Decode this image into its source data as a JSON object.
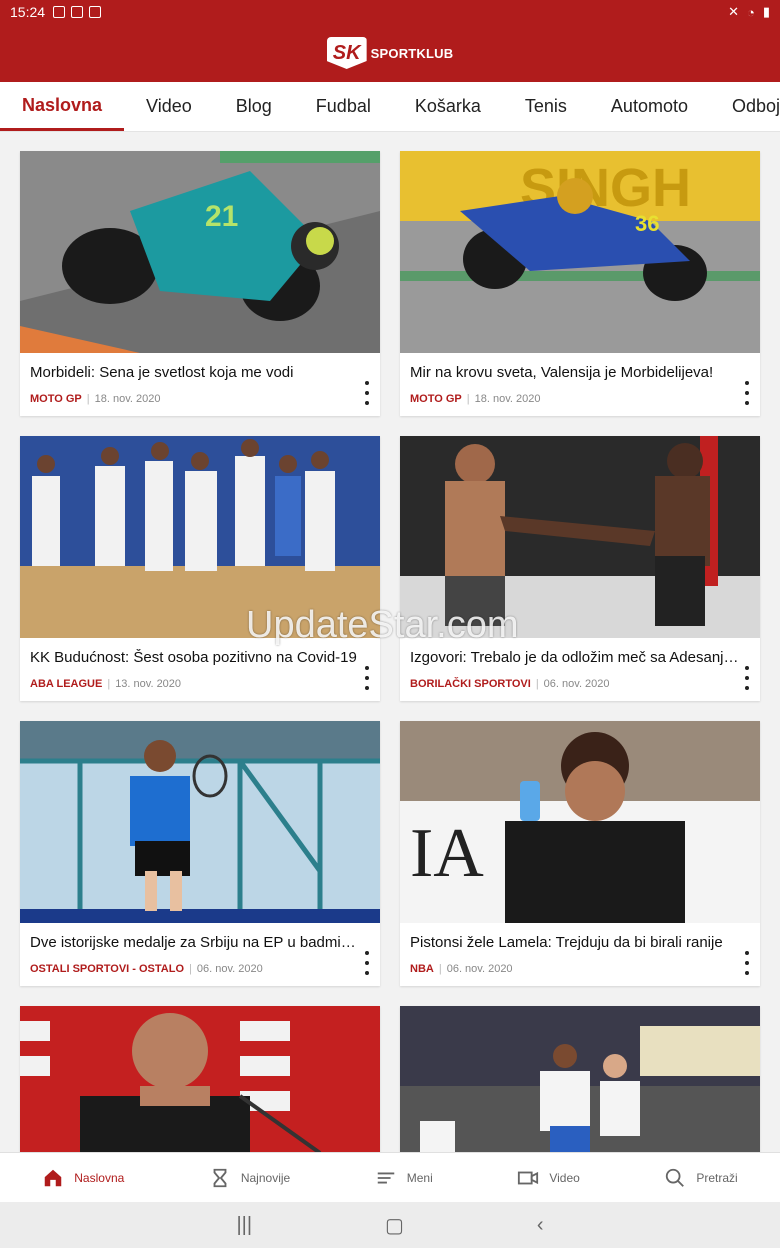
{
  "status_bar": {
    "time": "15:24"
  },
  "header": {
    "logo_badge": "SK",
    "logo_text": "SPORTKLUB"
  },
  "tabs": [
    {
      "label": "Naslovna",
      "active": true
    },
    {
      "label": "Video"
    },
    {
      "label": "Blog"
    },
    {
      "label": "Fudbal"
    },
    {
      "label": "Košarka"
    },
    {
      "label": "Tenis"
    },
    {
      "label": "Automoto"
    },
    {
      "label": "Odbojka"
    }
  ],
  "articles": [
    {
      "title": "Morbideli: Sena je svetlost koja me vodi",
      "category": "MOTO GP",
      "date": "18. nov. 2020",
      "image": "motogp-rider-yamaha"
    },
    {
      "title": "Mir na krovu sveta, Valensija je Morbidelijeva!",
      "category": "MOTO GP",
      "date": "18. nov. 2020",
      "image": "motogp-rider-suzuki"
    },
    {
      "title": "KK Budućnost: Šest osoba pozitivno na Covid-19",
      "category": "ABA LEAGUE",
      "date": "13. nov. 2020",
      "image": "basketball-team-celebration"
    },
    {
      "title": "Izgovori: Trebalo je da odložim meč sa Adesanj…",
      "category": "BORILAČKI SPORTOVI",
      "date": "06. nov. 2020",
      "image": "mma-fighters"
    },
    {
      "title": "Dve istorijske medalje za Srbiju na EP u badmin…",
      "category": "OSTALI SPORTOVI - OSTALO",
      "date": "06. nov. 2020",
      "image": "badminton-player"
    },
    {
      "title": "Pistonsi žele Lamela: Trejduju da bi birali ranije",
      "category": "NBA",
      "date": "06. nov. 2020",
      "image": "basketball-player-phone"
    },
    {
      "title": "",
      "category": "",
      "date": "",
      "image": "coach-press-conference"
    },
    {
      "title": "",
      "category": "",
      "date": "",
      "image": "basketball-dunk"
    }
  ],
  "watermark": "UpdateStar.com",
  "bottom_nav": [
    {
      "label": "Naslovna",
      "icon": "home-icon",
      "active": true
    },
    {
      "label": "Najnovije",
      "icon": "hourglass-icon"
    },
    {
      "label": "Meni",
      "icon": "menu-icon"
    },
    {
      "label": "Video",
      "icon": "video-icon"
    },
    {
      "label": "Pretraži",
      "icon": "search-icon"
    }
  ],
  "colors": {
    "brand": "#b01c1c"
  }
}
